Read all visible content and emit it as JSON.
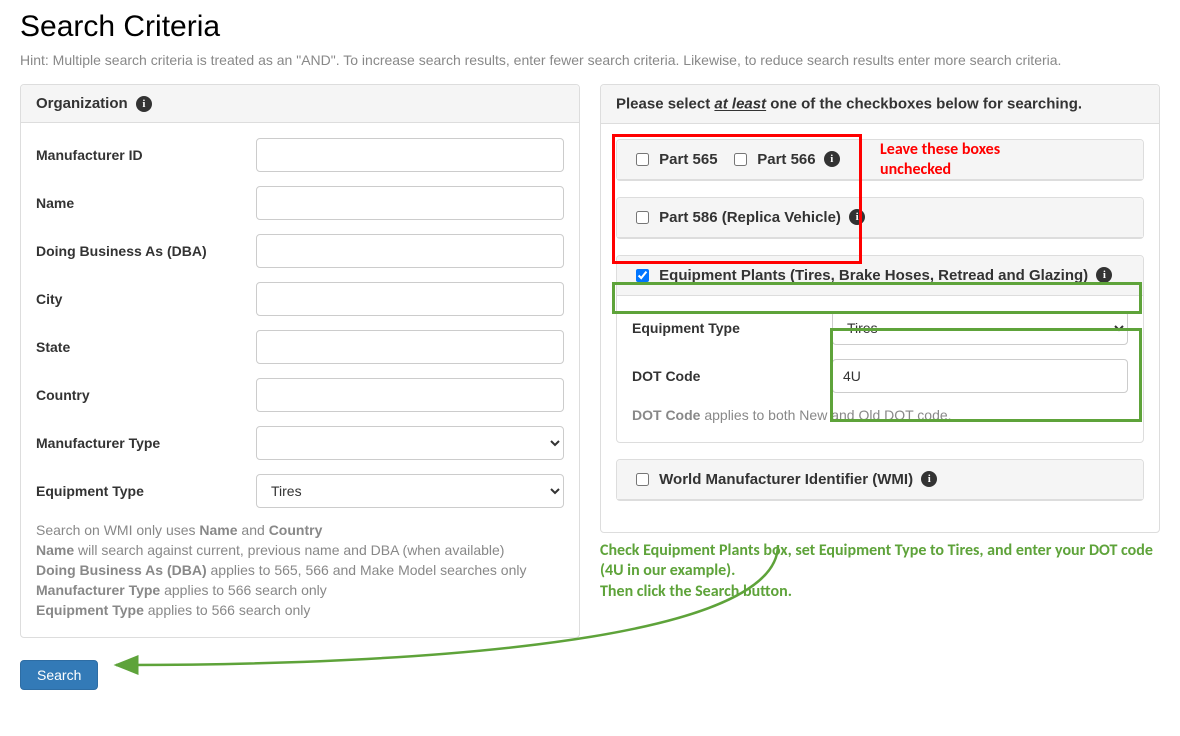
{
  "page": {
    "title": "Search Criteria",
    "hint": "Hint: Multiple search criteria is treated as an \"AND\". To increase search results, enter fewer search criteria. Likewise, to reduce search results enter more search criteria."
  },
  "org_panel": {
    "heading": "Organization",
    "fields": {
      "manufacturer_id": "Manufacturer ID",
      "name": "Name",
      "dba": "Doing Business As (DBA)",
      "city": "City",
      "state": "State",
      "country": "Country",
      "manufacturer_type": "Manufacturer Type",
      "equipment_type": "Equipment Type"
    },
    "equipment_type_value": "Tires",
    "help": {
      "l1a": "Search on WMI only uses ",
      "l1b": "Name",
      "l1c": " and ",
      "l1d": "Country",
      "l2a": "Name",
      "l2b": " will search against current, previous name and DBA (when available)",
      "l3a": "Doing Business As (DBA)",
      "l3b": " applies to 565, 566 and Make Model searches only",
      "l4a": "Manufacturer Type",
      "l4b": " applies to 566 search only",
      "l5a": "Equipment Type",
      "l5b": " applies to 566 search only"
    }
  },
  "right": {
    "instruction_a": "Please select ",
    "instruction_b": "at least",
    "instruction_c": " one of the checkboxes below for searching.",
    "part565": "Part 565",
    "part566": "Part 566",
    "part586": "Part 586 (Replica Vehicle)",
    "equip_plants": "Equipment Plants (Tires, Brake Hoses, Retread and Glazing)",
    "equip_type_label": "Equipment Type",
    "equip_type_value": "Tires",
    "dot_code_label": "DOT Code",
    "dot_code_value": "4U",
    "dot_note_a": "DOT Code",
    "dot_note_b": " applies to both New and Old DOT code.",
    "wmi": "World Manufacturer Identifier (WMI)"
  },
  "annotations": {
    "red_text": "Leave these boxes unchecked",
    "green_text": "Check Equipment Plants box, set Equipment Type to Tires, and enter your DOT code (4U in our example).\nThen click the Search button."
  },
  "search_button": "Search"
}
